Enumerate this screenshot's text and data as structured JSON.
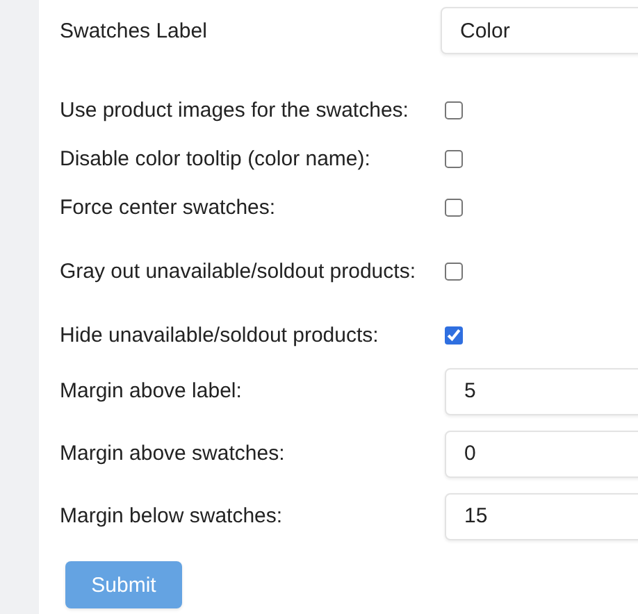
{
  "settings": [
    {
      "kind": "text",
      "label": "Swatches Label",
      "value": "Color"
    },
    {
      "kind": "checkbox",
      "label": "Use product images for the swatches:",
      "checked": false
    },
    {
      "kind": "checkbox",
      "label": "Disable color tooltip (color name):",
      "checked": false
    },
    {
      "kind": "checkbox",
      "label": "Force center swatches:",
      "checked": false
    },
    {
      "kind": "checkbox",
      "label": "Gray out unavailable/soldout products:",
      "checked": false
    },
    {
      "kind": "checkbox",
      "label": "Hide unavailable/soldout products:",
      "checked": true
    },
    {
      "kind": "number",
      "label": "Margin above label:",
      "value": "5"
    },
    {
      "kind": "number",
      "label": "Margin above swatches:",
      "value": "0"
    },
    {
      "kind": "number",
      "label": "Margin below swatches:",
      "value": "15"
    }
  ],
  "submit_button": {
    "label": "Submit",
    "disabled": true
  }
}
